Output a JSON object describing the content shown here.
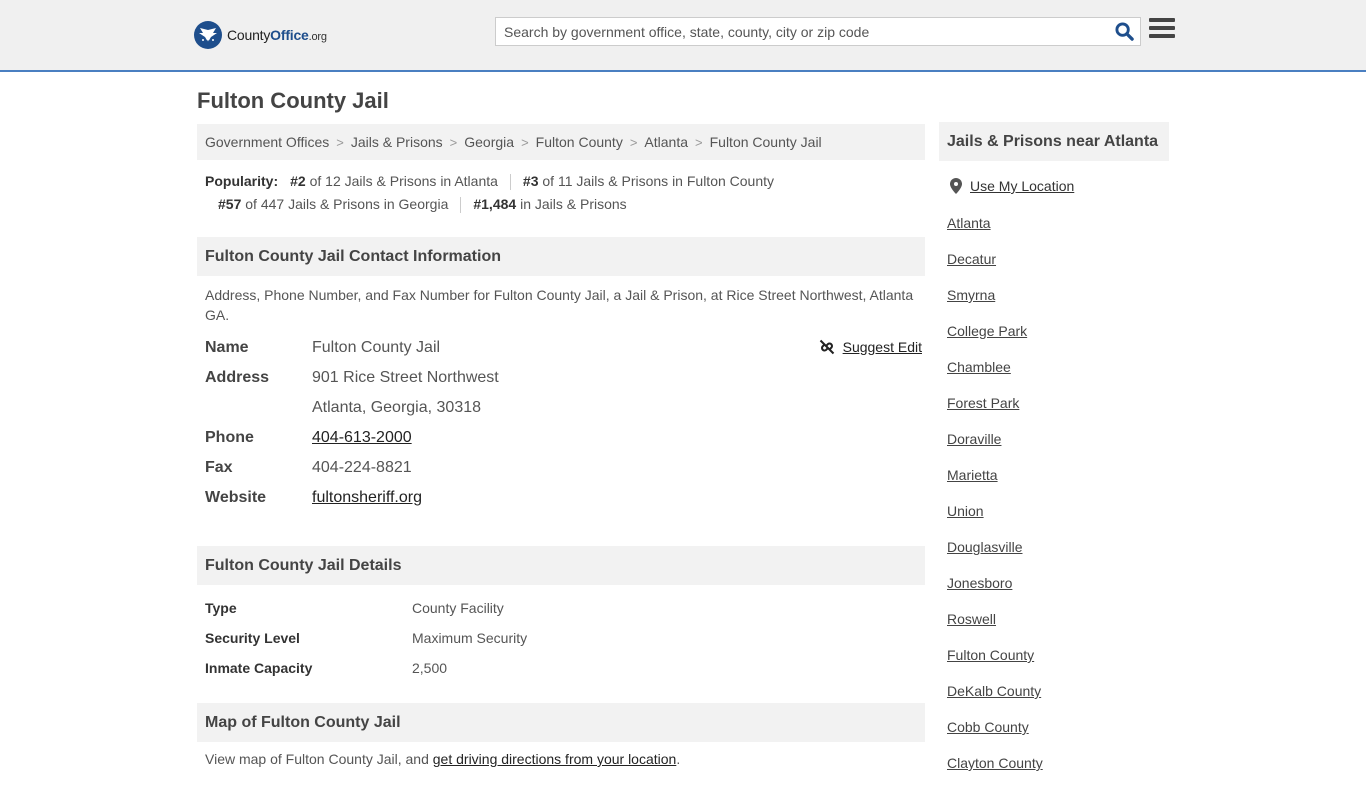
{
  "header": {
    "logo_county": "County",
    "logo_office": "Office",
    "logo_org": ".org",
    "search_placeholder": "Search by government office, state, county, city or zip code"
  },
  "page_title": "Fulton County Jail",
  "breadcrumb": [
    "Government Offices",
    "Jails & Prisons",
    "Georgia",
    "Fulton County",
    "Atlanta",
    "Fulton County Jail"
  ],
  "popularity": {
    "label": "Popularity:",
    "items": [
      {
        "rank": "#2",
        "text": " of 12 Jails & Prisons in Atlanta"
      },
      {
        "rank": "#3",
        "text": " of 11 Jails & Prisons in Fulton County"
      },
      {
        "rank": "#57",
        "text": " of 447 Jails & Prisons in Georgia"
      },
      {
        "rank": "#1,484",
        "text": " in Jails & Prisons"
      }
    ]
  },
  "contact_section": {
    "heading": "Fulton County Jail Contact Information",
    "description": "Address, Phone Number, and Fax Number for Fulton County Jail, a Jail & Prison, at Rice Street Northwest, Atlanta GA.",
    "suggest_edit": "Suggest Edit",
    "rows": {
      "name_label": "Name",
      "name": "Fulton County Jail",
      "address_label": "Address",
      "address_line1": "901 Rice Street Northwest",
      "address_line2": "Atlanta, Georgia, 30318",
      "phone_label": "Phone",
      "phone": "404-613-2000",
      "fax_label": "Fax",
      "fax": "404-224-8821",
      "website_label": "Website",
      "website": "fultonsheriff.org"
    }
  },
  "details_section": {
    "heading": "Fulton County Jail Details",
    "rows": [
      {
        "label": "Type",
        "value": "County Facility"
      },
      {
        "label": "Security Level",
        "value": "Maximum Security"
      },
      {
        "label": "Inmate Capacity",
        "value": "2,500"
      }
    ]
  },
  "map_section": {
    "heading": "Map of Fulton County Jail",
    "text_before": "View map of Fulton County Jail, and ",
    "link": "get driving directions from your location",
    "text_after": "."
  },
  "sidebar": {
    "heading": "Jails & Prisons near Atlanta",
    "use_location": "Use My Location",
    "links": [
      "Atlanta",
      "Decatur",
      "Smyrna",
      "College Park",
      "Chamblee",
      "Forest Park",
      "Doraville",
      "Marietta",
      "Union",
      "Douglasville",
      "Jonesboro",
      "Roswell",
      "Fulton County",
      "DeKalb County",
      "Cobb County",
      "Clayton County"
    ]
  },
  "colors": {
    "brand_blue": "#1e4e8c",
    "header_bg": "#f0f0f0",
    "header_border": "#4a7fc1",
    "section_bg": "#f2f2f2"
  },
  "icons": [
    "eagle-logo-icon",
    "search-icon",
    "hamburger-menu-icon",
    "suggest-edit-icon",
    "location-pin-icon"
  ]
}
